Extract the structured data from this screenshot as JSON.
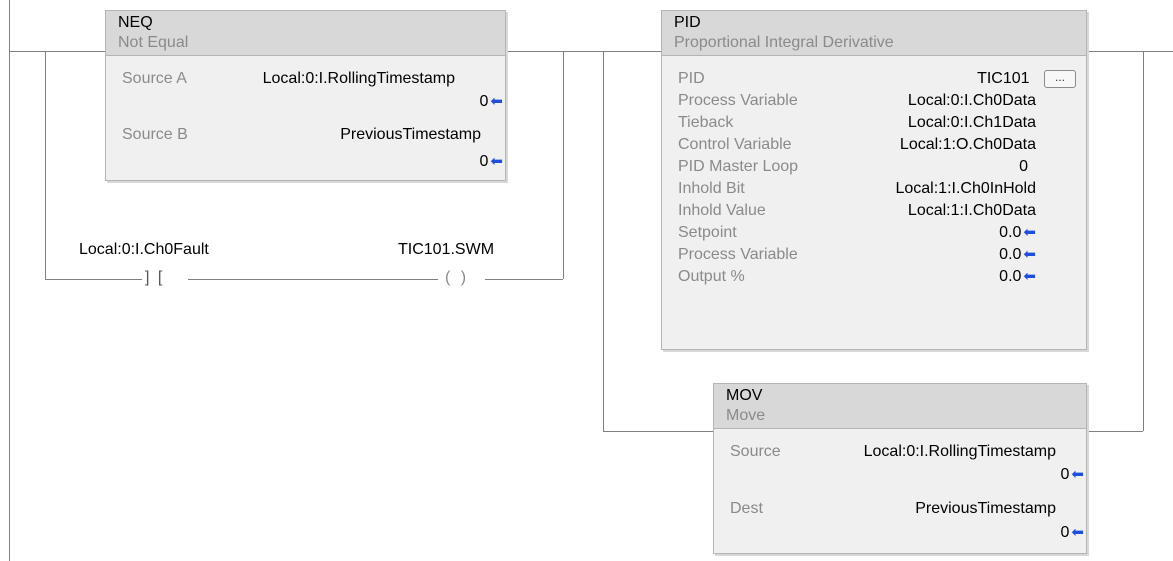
{
  "neq": {
    "name": "NEQ",
    "desc": "Not Equal",
    "source_a_label": "Source A",
    "source_a_tag": "Local:0:I.RollingTimestamp",
    "source_a_value": "0",
    "source_b_label": "Source B",
    "source_b_tag": "PreviousTimestamp",
    "source_b_value": "0"
  },
  "contact": {
    "tag": "Local:0:I.Ch0Fault",
    "glyph": "] ["
  },
  "coil": {
    "tag": "TIC101.SWM",
    "glyph": "( )"
  },
  "pid": {
    "name": "PID",
    "desc": "Proportional Integral Derivative",
    "rows": [
      {
        "label": "PID",
        "value": "TIC101"
      },
      {
        "label": "Process Variable",
        "value": "Local:0:I.Ch0Data"
      },
      {
        "label": "Tieback",
        "value": "Local:0:I.Ch1Data"
      },
      {
        "label": "Control Variable",
        "value": "Local:1:O.Ch0Data"
      },
      {
        "label": "PID Master Loop",
        "value": "0"
      },
      {
        "label": "Inhold Bit",
        "value": "Local:1:I.Ch0InHold"
      },
      {
        "label": "Inhold Value",
        "value": "Local:1:I.Ch0Data"
      },
      {
        "label": "Setpoint",
        "value": "0.0"
      },
      {
        "label": "Process Variable",
        "value": "0.0"
      },
      {
        "label": "Output %",
        "value": "0.0"
      }
    ],
    "ellipsis": "..."
  },
  "mov": {
    "name": "MOV",
    "desc": "Move",
    "source_label": "Source",
    "source_tag": "Local:0:I.RollingTimestamp",
    "source_value": "0",
    "dest_label": "Dest",
    "dest_tag": "PreviousTimestamp",
    "dest_value": "0"
  },
  "icons": {
    "value-arrow": "arrow-left-icon"
  },
  "colors": {
    "arrow": "#1f4fd8",
    "wire": "#808080",
    "block_header": "#d8d8d8"
  }
}
